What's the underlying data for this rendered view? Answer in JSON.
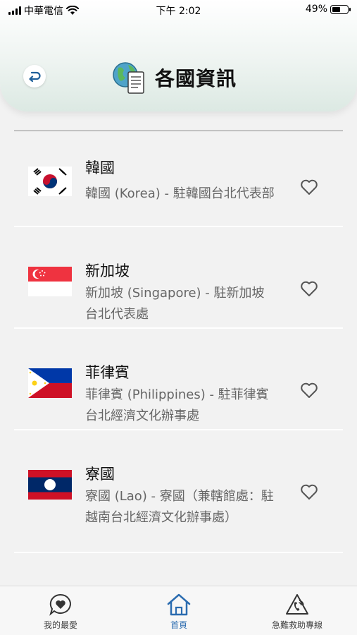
{
  "status_bar": {
    "carrier": "中華電信",
    "time": "下午 2:02",
    "battery": "49%"
  },
  "header": {
    "title": "各國資訊",
    "icons": {
      "back": "return-arrow-icon",
      "title": "globe-document-icon"
    }
  },
  "countries": [
    {
      "name": "韓國",
      "desc": "韓國 (Korea) - 駐韓國台北代表部",
      "flag": "korea-flag",
      "heart": "heart-outline-icon"
    },
    {
      "name": "新加坡",
      "desc": "新加坡 (Singapore) - 駐新加坡台北代表處",
      "flag": "singapore-flag",
      "heart": "heart-outline-icon"
    },
    {
      "name": "菲律賓",
      "desc": "菲律賓 (Philippines) - 駐菲律賓台北經濟文化辦事處",
      "flag": "philippines-flag",
      "heart": "heart-outline-icon"
    },
    {
      "name": "寮國",
      "desc": "寮國 (Lao) - 寮國（兼轄館處：駐越南台北經濟文化辦事處）",
      "flag": "laos-flag",
      "heart": "heart-outline-icon"
    }
  ],
  "tabbar": {
    "favorites": "我的最愛",
    "home": "首頁",
    "emergency": "急難救助專線"
  },
  "colors": {
    "accent": "#2b6cb0",
    "header_gradient_end": "#dce9e3",
    "background": "#f2f2f2"
  }
}
